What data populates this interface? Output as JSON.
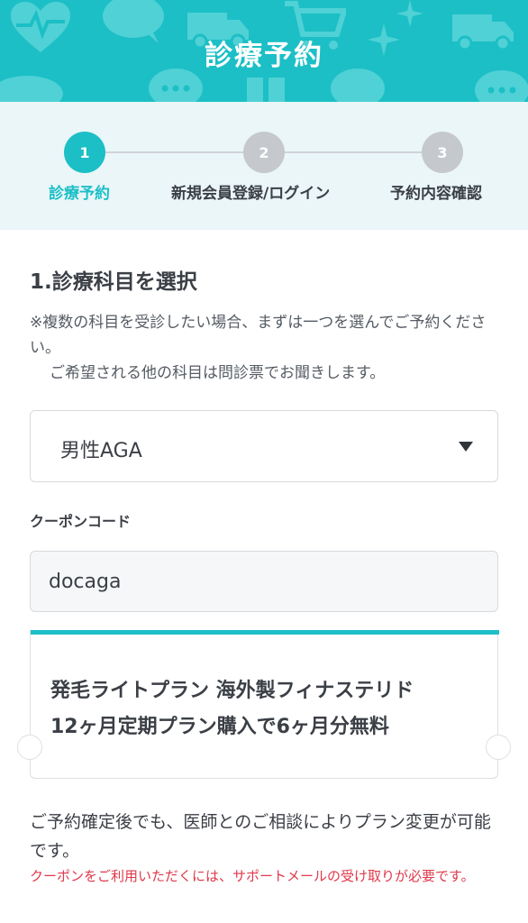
{
  "header": {
    "title": "診療予約"
  },
  "colors": {
    "brand": "#1cbfc6",
    "step_active": "#1cbfc6",
    "step_inactive": "#c5c8cc",
    "warning": "#e0384a"
  },
  "stepper": {
    "steps": [
      {
        "number": "1",
        "label": "診療予約",
        "active": true
      },
      {
        "number": "2",
        "label": "新規会員登録/ログイン",
        "active": false
      },
      {
        "number": "3",
        "label": "予約内容確認",
        "active": false
      }
    ]
  },
  "section": {
    "title": "1.診療科目を選択",
    "note_line1": "※複数の科目を受診したい場合、まずは一つを選んでご予約ください。",
    "note_line2": "ご希望される他の科目は問診票でお聞きします。"
  },
  "subject_select": {
    "value": "男性AGA"
  },
  "coupon": {
    "label": "クーポンコード",
    "value": "docaga",
    "offer_line1": "発毛ライトプラン 海外製フィナステリド",
    "offer_line2": "12ヶ月定期プラン購入で6ヶ月分無料"
  },
  "footer": {
    "info": "ご予約確定後でも、医師とのご相談によりプラン変更が可能です。",
    "warning": "クーポンをご利用いただくには、サポートメールの受け取りが必要です。"
  }
}
